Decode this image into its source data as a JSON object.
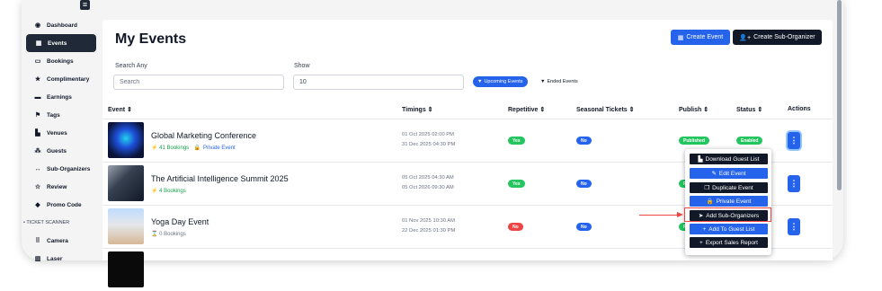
{
  "sidebar": {
    "items": [
      {
        "icon": "dashboard-icon",
        "glyph": "◉",
        "label": "Dashboard"
      },
      {
        "icon": "calendar-icon",
        "glyph": "▦",
        "label": "Events"
      },
      {
        "icon": "ticket-icon",
        "glyph": "▭",
        "label": "Bookings"
      },
      {
        "icon": "star-icon",
        "glyph": "★",
        "label": "Complimentary"
      },
      {
        "icon": "wallet-icon",
        "glyph": "▬",
        "label": "Earnings"
      },
      {
        "icon": "tags-icon",
        "glyph": "⚑",
        "label": "Tags"
      },
      {
        "icon": "venue-icon",
        "glyph": "▙",
        "label": "Venues"
      },
      {
        "icon": "guests-icon",
        "glyph": "⁂",
        "label": "Guests"
      },
      {
        "icon": "sub-organizers-icon",
        "glyph": "↔",
        "label": "Sub-Organizers"
      },
      {
        "icon": "review-icon",
        "glyph": "☆",
        "label": "Review"
      },
      {
        "icon": "promo-code-icon",
        "glyph": "◆",
        "label": "Promo Code"
      }
    ],
    "section_label": "• TICKET SCANNER",
    "scanner_items": [
      {
        "icon": "camera-icon",
        "glyph": "⠿",
        "label": "Camera"
      },
      {
        "icon": "laser-icon",
        "glyph": "▥",
        "label": "Laser"
      }
    ]
  },
  "header": {
    "title": "My Events",
    "create_event_label": "Create Event",
    "create_sub_label": "Create Sub-Organizer"
  },
  "filters": {
    "search_label": "Search Any",
    "search_placeholder": "Search",
    "show_label": "Show",
    "show_value": "10",
    "upcoming_label": "Upcoming Events",
    "ended_label": "Ended Events"
  },
  "table": {
    "columns": [
      "Event",
      "Timings",
      "Repetitive",
      "Seasonal Tickets",
      "Publish",
      "Status",
      "Actions"
    ],
    "rows": [
      {
        "title": "Global Marketing Conference",
        "bookings": "41 Bookings",
        "private": "Private Event",
        "start": "01 Oct 2025 02:00 PM",
        "end": "31 Dec 2025 04:30 PM",
        "repetitive": "Yes",
        "seasonal": "No",
        "publish": "Published",
        "status": "Enabled"
      },
      {
        "title": "The Artificial Intelligence Summit 2025",
        "bookings": "4 Bookings",
        "start": "05 Oct 2025 04:30 AM",
        "end": "05 Oct 2026 09:30 AM",
        "repetitive": "Yes",
        "seasonal": "No",
        "publish": "P"
      },
      {
        "title": "Yoga Day Event",
        "bookings": "0 Bookings",
        "start": "01 Nov 2025 10:30 AM",
        "end": "22 Dec 2025 01:30 PM",
        "repetitive": "No",
        "seasonal": "No",
        "publish": "P"
      }
    ],
    "action_glyph": "⋮"
  },
  "action_menu": {
    "items": [
      {
        "label": "Download Guest List",
        "icon": "document-icon",
        "glyph": "▙"
      },
      {
        "label": "Edit Event",
        "icon": "edit-icon",
        "glyph": "✎"
      },
      {
        "label": "Duplicate Event",
        "icon": "copy-icon",
        "glyph": "❐"
      },
      {
        "label": "Private Event",
        "icon": "lock-icon",
        "glyph": "🔒"
      },
      {
        "label": "Add Sub-Organizers",
        "icon": "send-icon",
        "glyph": "➤"
      },
      {
        "label": "Add To Guest List",
        "icon": "plus-icon",
        "glyph": "+"
      },
      {
        "label": "Export Sales Report",
        "icon": "plus-icon",
        "glyph": "+"
      }
    ]
  },
  "colors": {
    "primary": "#2563eb",
    "dark": "#111827",
    "success": "#22c55e",
    "danger": "#ef4444",
    "annotation": "#ef4444"
  }
}
